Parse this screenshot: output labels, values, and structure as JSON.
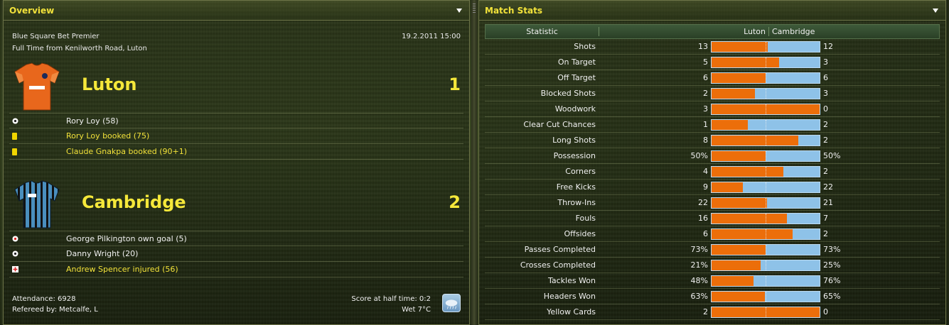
{
  "overview": {
    "title": "Overview",
    "competition": "Blue Square Bet Premier",
    "datetime": "19.2.2011 15:00",
    "result_line": "Full Time from Kenilworth Road, Luton",
    "home": {
      "name": "Luton",
      "score": "1",
      "kit_colors": {
        "body": "#e8671c",
        "sleeve": "#ffffff"
      },
      "events": [
        {
          "type": "goal",
          "icon": "ball-icon",
          "text": "Rory Loy (58)"
        },
        {
          "type": "yellow",
          "icon": "yellow-card-icon",
          "text": "Rory Loy booked (75)"
        },
        {
          "type": "yellow",
          "icon": "yellow-card-icon",
          "text": "Claude Gnakpa booked (90+1)"
        }
      ]
    },
    "away": {
      "name": "Cambridge",
      "score": "2",
      "kit_colors": {
        "body": "#4a8fbe",
        "stripe": "#111111"
      },
      "events": [
        {
          "type": "own-goal",
          "icon": "own-goal-ball-icon",
          "text": "George Pilkington own goal (5)"
        },
        {
          "type": "goal",
          "icon": "ball-icon",
          "text": "Danny Wright (20)"
        },
        {
          "type": "injury",
          "icon": "injury-icon",
          "text": "Andrew Spencer injured (56)"
        }
      ]
    },
    "attendance": "Attendance: 6928",
    "referee": "Refereed by: Metcalfe, L",
    "halftime": "Score at half time: 0:2",
    "weather": "Wet 7°C",
    "weather_icon": "rain-cloud-icon"
  },
  "stats": {
    "title": "Match Stats",
    "headers": {
      "stat": "Statistic",
      "home": "Luton",
      "away": "Cambridge"
    },
    "colors": {
      "home": "#ec6e0a",
      "away": "#8ec2e8"
    },
    "rows": [
      {
        "label": "Shots",
        "home": "13",
        "away": "12",
        "share": 0.52
      },
      {
        "label": "On Target",
        "home": "5",
        "away": "3",
        "share": 0.625
      },
      {
        "label": "Off Target",
        "home": "6",
        "away": "6",
        "share": 0.5
      },
      {
        "label": "Blocked Shots",
        "home": "2",
        "away": "3",
        "share": 0.4
      },
      {
        "label": "Woodwork",
        "home": "3",
        "away": "0",
        "share": 1.0
      },
      {
        "label": "Clear Cut Chances",
        "home": "1",
        "away": "2",
        "share": 0.333
      },
      {
        "label": "Long Shots",
        "home": "8",
        "away": "2",
        "share": 0.8
      },
      {
        "label": "Possession",
        "home": "50%",
        "away": "50%",
        "share": 0.5
      },
      {
        "label": "Corners",
        "home": "4",
        "away": "2",
        "share": 0.667
      },
      {
        "label": "Free Kicks",
        "home": "9",
        "away": "22",
        "share": 0.29
      },
      {
        "label": "Throw-Ins",
        "home": "22",
        "away": "21",
        "share": 0.512
      },
      {
        "label": "Fouls",
        "home": "16",
        "away": "7",
        "share": 0.696
      },
      {
        "label": "Offsides",
        "home": "6",
        "away": "2",
        "share": 0.75
      },
      {
        "label": "Passes Completed",
        "home": "73%",
        "away": "73%",
        "share": 0.5
      },
      {
        "label": "Crosses Completed",
        "home": "21%",
        "away": "25%",
        "share": 0.457
      },
      {
        "label": "Tackles Won",
        "home": "48%",
        "away": "76%",
        "share": 0.387
      },
      {
        "label": "Headers Won",
        "home": "63%",
        "away": "65%",
        "share": 0.492
      },
      {
        "label": "Yellow Cards",
        "home": "2",
        "away": "0",
        "share": 1.0
      }
    ]
  }
}
